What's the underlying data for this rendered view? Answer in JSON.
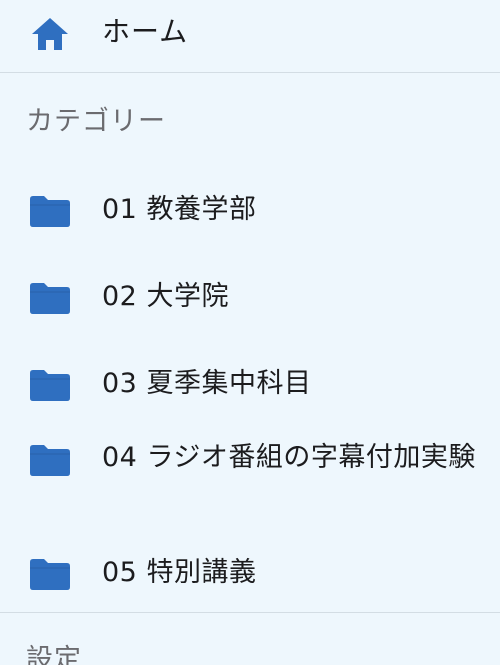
{
  "nav": {
    "home_label": "ホーム"
  },
  "categories": {
    "header": "カテゴリー",
    "items": [
      {
        "label": "01 教養学部"
      },
      {
        "label": "02 大学院"
      },
      {
        "label": "03 夏季集中科目"
      },
      {
        "label": "04 ラジオ番組の字幕付加実験"
      },
      {
        "label": "05 特別講義"
      }
    ]
  },
  "settings": {
    "header": "設定"
  },
  "colors": {
    "background": "#eef7fd",
    "accent": "#2f6fc0",
    "divider": "#d3dde4",
    "header_text": "#6b6b6f"
  }
}
